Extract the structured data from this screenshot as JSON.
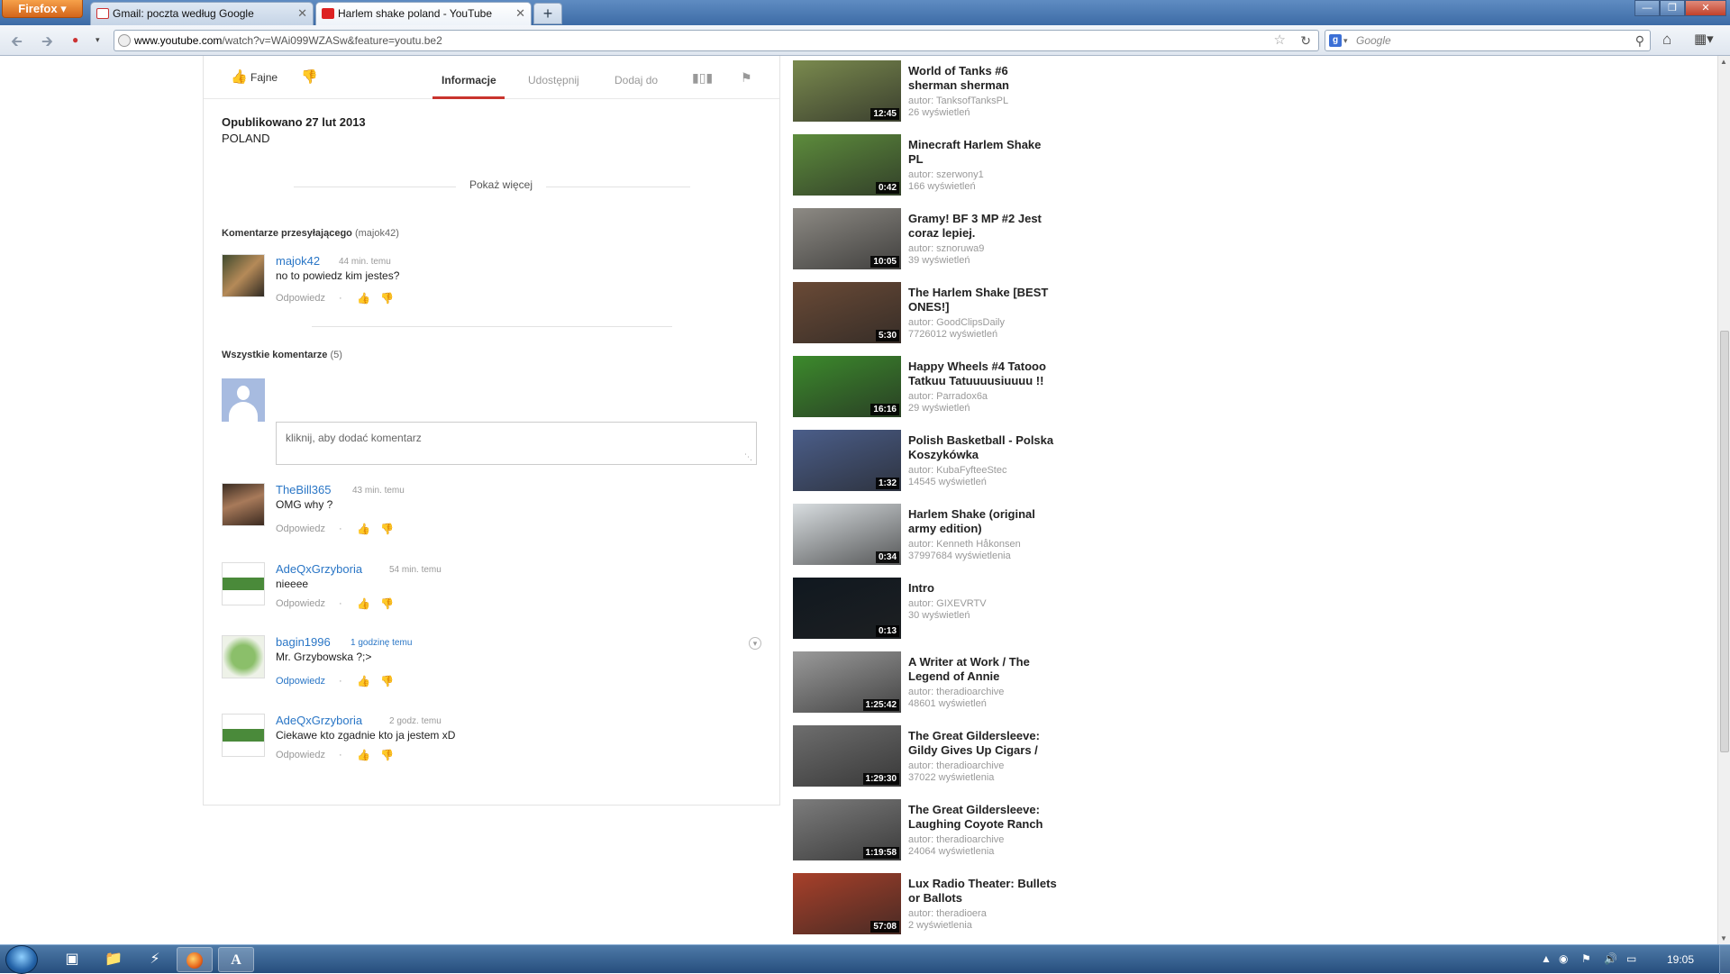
{
  "browser": {
    "app_button": "Firefox",
    "tabs": [
      {
        "label": "Gmail: poczta według Google",
        "icon": "gmail-icon"
      },
      {
        "label": "Harlem shake poland - YouTube",
        "icon": "youtube-icon"
      }
    ],
    "new_tab": "+",
    "url_domain": "www.youtube.com",
    "url_rest": "/watch?v=WAi099WZASw&feature=youtu.be2",
    "search_placeholder": "Google"
  },
  "actions": {
    "like": "Fajne",
    "tabs": [
      "Informacje",
      "Udostępnij",
      "Dodaj do"
    ]
  },
  "info": {
    "published": "Opublikowano 27 lut 2013",
    "description": "POLAND",
    "show_more": "Pokaż więcej"
  },
  "uploader_comments": {
    "heading": "Komentarze przesyłającego",
    "heading_user": "(majok42)",
    "items": [
      {
        "user": "majok42",
        "time": "44 min. temu",
        "text": "no to powiedz kim jestes?",
        "reply": "Odpowiedz"
      }
    ]
  },
  "all_comments": {
    "heading": "Wszystkie komentarze",
    "count": "(5)",
    "add_placeholder": "kliknij, aby dodać komentarz",
    "items": [
      {
        "user": "TheBill365",
        "time": "43 min. temu",
        "text": "OMG why ?",
        "reply": "Odpowiedz"
      },
      {
        "user": "AdeQxGrzyboria",
        "time": "54 min. temu",
        "text": "nieeee",
        "reply": "Odpowiedz"
      },
      {
        "user": "bagin1996",
        "time": "1 godzinę temu",
        "text": "Mr. Grzybowska ?;>",
        "reply": "Odpowiedz"
      },
      {
        "user": "AdeQxGrzyboria",
        "time": "2 godz. temu",
        "text": "Ciekawe kto zgadnie kto ja jestem xD",
        "reply": "Odpowiedz"
      }
    ]
  },
  "related": [
    {
      "title": "World of Tanks #6 sherman sherman",
      "author": "autor: TanksofTanksPL",
      "views": "26 wyświetleń",
      "duration": "12:45",
      "color": "#7a8a4e"
    },
    {
      "title": "Minecraft Harlem Shake PL",
      "author": "autor: szerwony1",
      "views": "166 wyświetleń",
      "duration": "0:42",
      "color": "#5d8c3c"
    },
    {
      "title": "Gramy! BF 3 MP #2 Jest coraz lepiej.",
      "author": "autor: sznoruwa9",
      "views": "39 wyświetleń",
      "duration": "10:05",
      "color": "#8d8a84"
    },
    {
      "title": "The Harlem Shake [BEST ONES!]",
      "author": "autor: GoodClipsDaily",
      "views": "7726012 wyświetleń",
      "duration": "5:30",
      "color": "#6a4a36"
    },
    {
      "title": "Happy Wheels #4 Tatooo Tatkuu Tatuuuusiuuuu !!",
      "author": "autor: Parradox6a",
      "views": "29 wyświetleń",
      "duration": "16:16",
      "color": "#3c8a2c"
    },
    {
      "title": "Polish Basketball - Polska Koszykówka",
      "author": "autor: KubaFyfteeStec",
      "views": "14545 wyświetleń",
      "duration": "1:32",
      "color": "#4b5e8a"
    },
    {
      "title": "Harlem Shake (original army edition)",
      "author": "autor: Kenneth Håkonsen",
      "views": "37997684 wyświetlenia",
      "duration": "0:34",
      "color": "#d8dde0"
    },
    {
      "title": "Intro",
      "author": "autor: GIXEVRTV",
      "views": "30 wyświetleń",
      "duration": "0:13",
      "color": "#101820"
    },
    {
      "title": "A Writer at Work / The Legend of Annie",
      "author": "autor: theradioarchive",
      "views": "48601 wyświetleń",
      "duration": "1:25:42",
      "color": "#9a9a9a"
    },
    {
      "title": "The Great Gildersleeve: Gildy Gives Up Cigars /",
      "author": "autor: theradioarchive",
      "views": "37022 wyświetlenia",
      "duration": "1:29:30",
      "color": "#6e6e6e"
    },
    {
      "title": "The Great Gildersleeve: Laughing Coyote Ranch",
      "author": "autor: theradioarchive",
      "views": "24064 wyświetlenia",
      "duration": "1:19:58",
      "color": "#7c7c7c"
    },
    {
      "title": "Lux Radio Theater: Bullets or Ballots",
      "author": "autor: theradioera",
      "views": "2 wyświetlenia",
      "duration": "57:08",
      "color": "#a8402a"
    }
  ],
  "taskbar": {
    "clock": "19:05",
    "apps": [
      "desktop-app-icon",
      "explorer-icon",
      "app-icon",
      "firefox-icon",
      "font-app-icon"
    ]
  }
}
